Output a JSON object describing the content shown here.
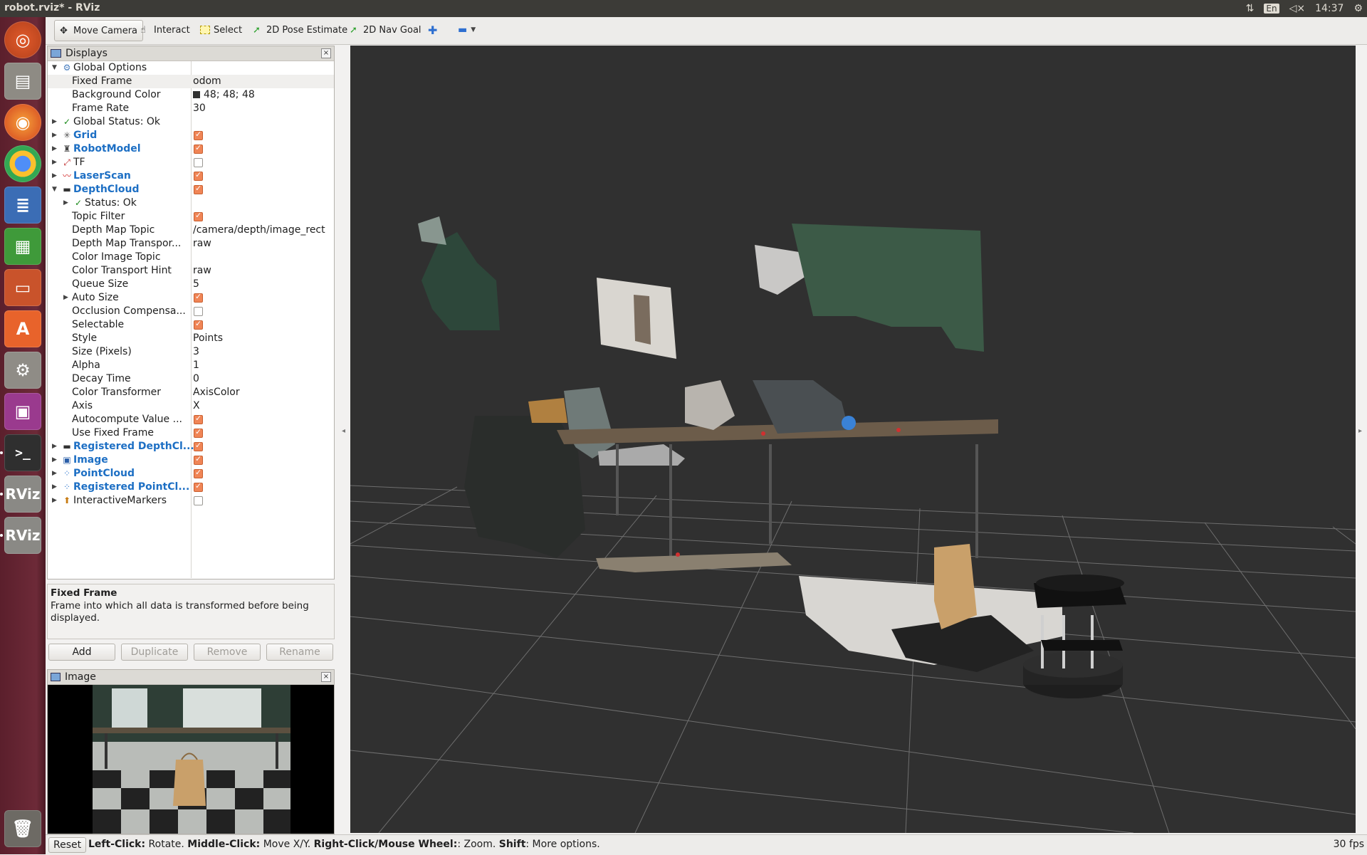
{
  "window": {
    "title": "robot.rviz* - RViz"
  },
  "top_panel": {
    "lang": "En",
    "clock": "14:37"
  },
  "toolbar": {
    "move_camera": "Move Camera",
    "interact": "Interact",
    "select": "Select",
    "pose_estimate": "2D Pose Estimate",
    "nav_goal": "2D Nav Goal"
  },
  "displays": {
    "title": "Displays",
    "rows": [
      {
        "label": "Global Options",
        "indent": 0,
        "arrow": "down",
        "icon": "gear-icon",
        "value": "",
        "checkbox": null,
        "blue": false
      },
      {
        "label": "Fixed Frame",
        "indent": 1,
        "arrow": "",
        "icon": "",
        "value": "odom",
        "checkbox": null,
        "blue": false,
        "selected": true
      },
      {
        "label": "Background Color",
        "indent": 1,
        "arrow": "",
        "icon": "",
        "value": "48; 48; 48",
        "swatch": true,
        "checkbox": null,
        "blue": false
      },
      {
        "label": "Frame Rate",
        "indent": 1,
        "arrow": "",
        "icon": "",
        "value": "30",
        "checkbox": null,
        "blue": false
      },
      {
        "label": "Global Status: Ok",
        "indent": 0,
        "arrow": "right",
        "icon": "check-icon",
        "value": "",
        "checkbox": null,
        "blue": false
      },
      {
        "label": "Grid",
        "indent": 0,
        "arrow": "right",
        "icon": "grid-icon",
        "value": "",
        "checkbox": true,
        "blue": true
      },
      {
        "label": "RobotModel",
        "indent": 0,
        "arrow": "right",
        "icon": "robot-model-icon",
        "value": "",
        "checkbox": true,
        "blue": true
      },
      {
        "label": "TF",
        "indent": 0,
        "arrow": "right",
        "icon": "tf-axes-icon",
        "value": "",
        "checkbox": false,
        "blue": false
      },
      {
        "label": "LaserScan",
        "indent": 0,
        "arrow": "right",
        "icon": "laser-scan-icon",
        "value": "",
        "checkbox": true,
        "blue": true
      },
      {
        "label": "DepthCloud",
        "indent": 0,
        "arrow": "down",
        "icon": "depth-camera-icon",
        "value": "",
        "checkbox": true,
        "blue": true
      },
      {
        "label": "Status: Ok",
        "indent": 1,
        "arrow": "right",
        "icon": "check-icon",
        "value": "",
        "checkbox": null,
        "blue": false
      },
      {
        "label": "Topic Filter",
        "indent": 1,
        "arrow": "",
        "icon": "",
        "value": "",
        "checkbox": true,
        "blue": false
      },
      {
        "label": "Depth Map Topic",
        "indent": 1,
        "arrow": "",
        "icon": "",
        "value": "/camera/depth/image_rect",
        "checkbox": null,
        "blue": false
      },
      {
        "label": "Depth Map Transpor...",
        "indent": 1,
        "arrow": "",
        "icon": "",
        "value": "raw",
        "checkbox": null,
        "blue": false
      },
      {
        "label": "Color Image Topic",
        "indent": 1,
        "arrow": "",
        "icon": "",
        "value": "",
        "checkbox": null,
        "blue": false
      },
      {
        "label": "Color Transport Hint",
        "indent": 1,
        "arrow": "",
        "icon": "",
        "value": "raw",
        "checkbox": null,
        "blue": false
      },
      {
        "label": "Queue Size",
        "indent": 1,
        "arrow": "",
        "icon": "",
        "value": "5",
        "checkbox": null,
        "blue": false
      },
      {
        "label": "Auto Size",
        "indent": 1,
        "arrow": "right",
        "icon": "",
        "value": "",
        "checkbox": true,
        "blue": false
      },
      {
        "label": "Occlusion Compensa...",
        "indent": 1,
        "arrow": "",
        "icon": "",
        "value": "",
        "checkbox": false,
        "blue": false
      },
      {
        "label": "Selectable",
        "indent": 1,
        "arrow": "",
        "icon": "",
        "value": "",
        "checkbox": true,
        "blue": false
      },
      {
        "label": "Style",
        "indent": 1,
        "arrow": "",
        "icon": "",
        "value": "Points",
        "checkbox": null,
        "blue": false
      },
      {
        "label": "Size (Pixels)",
        "indent": 1,
        "arrow": "",
        "icon": "",
        "value": "3",
        "checkbox": null,
        "blue": false
      },
      {
        "label": "Alpha",
        "indent": 1,
        "arrow": "",
        "icon": "",
        "value": "1",
        "checkbox": null,
        "blue": false
      },
      {
        "label": "Decay Time",
        "indent": 1,
        "arrow": "",
        "icon": "",
        "value": "0",
        "checkbox": null,
        "blue": false
      },
      {
        "label": "Color Transformer",
        "indent": 1,
        "arrow": "",
        "icon": "",
        "value": "AxisColor",
        "checkbox": null,
        "blue": false
      },
      {
        "label": "Axis",
        "indent": 1,
        "arrow": "",
        "icon": "",
        "value": "X",
        "checkbox": null,
        "blue": false
      },
      {
        "label": "Autocompute Value ...",
        "indent": 1,
        "arrow": "",
        "icon": "",
        "value": "",
        "checkbox": true,
        "blue": false
      },
      {
        "label": "Use Fixed Frame",
        "indent": 1,
        "arrow": "",
        "icon": "",
        "value": "",
        "checkbox": true,
        "blue": false
      },
      {
        "label": "Registered DepthCl...",
        "indent": 0,
        "arrow": "right",
        "icon": "depth-camera-icon",
        "value": "",
        "checkbox": true,
        "blue": true
      },
      {
        "label": "Image",
        "indent": 0,
        "arrow": "right",
        "icon": "image-icon",
        "value": "",
        "checkbox": true,
        "blue": true
      },
      {
        "label": "PointCloud",
        "indent": 0,
        "arrow": "right",
        "icon": "point-cloud-icon",
        "value": "",
        "checkbox": true,
        "blue": true
      },
      {
        "label": "Registered PointCl...",
        "indent": 0,
        "arrow": "right",
        "icon": "point-cloud-icon",
        "value": "",
        "checkbox": true,
        "blue": true
      },
      {
        "label": "InteractiveMarkers",
        "indent": 0,
        "arrow": "right",
        "icon": "interactive-markers-icon",
        "value": "",
        "checkbox": false,
        "blue": false
      }
    ]
  },
  "description": {
    "title": "Fixed Frame",
    "text": "Frame into which all data is transformed before being displayed."
  },
  "buttons": {
    "add": "Add",
    "duplicate": "Duplicate",
    "remove": "Remove",
    "rename": "Rename"
  },
  "image_panel": {
    "title": "Image"
  },
  "status_bar": {
    "reset": "Reset",
    "k1": "Left-Click:",
    "v1": " Rotate. ",
    "k2": "Middle-Click:",
    "v2": " Move X/Y. ",
    "k3": "Right-Click/Mouse Wheel:",
    "v3": ": Zoom. ",
    "k4": "Shift",
    "v4": ": More options.",
    "fps": "30 fps"
  },
  "colors": {
    "background": "#303030",
    "accent_checkbox": "#f08556",
    "launcher": "#5b1f2c"
  }
}
